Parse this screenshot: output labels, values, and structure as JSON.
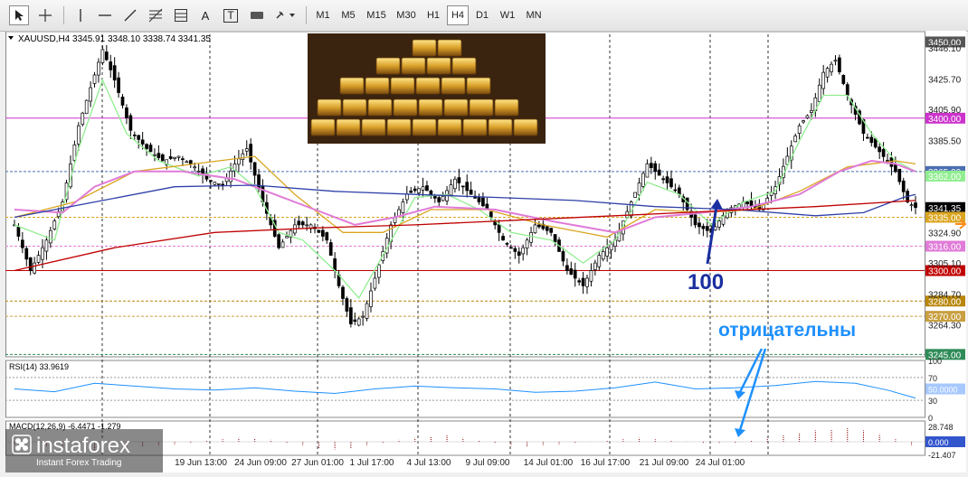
{
  "toolbar": {
    "tools": [
      {
        "name": "cursor-tool",
        "icon": "cursor-arrow-icon",
        "active": true
      },
      {
        "name": "crosshair-tool",
        "icon": "crosshair-icon"
      },
      {
        "name": "vertical-line-tool",
        "icon": "vertical-line-icon"
      },
      {
        "name": "horizontal-line-tool",
        "icon": "horizontal-line-icon"
      },
      {
        "name": "trendline-tool",
        "icon": "trendline-icon"
      },
      {
        "name": "fibonacci-tool",
        "icon": "fibonacci-grid-icon"
      },
      {
        "name": "text-tool",
        "icon": "text-a-icon",
        "label": "A"
      },
      {
        "name": "text-label-tool",
        "icon": "text-label-icon",
        "label": "T"
      },
      {
        "name": "rectangle-tool",
        "icon": "rectangle-icon"
      },
      {
        "name": "shapes-tool",
        "icon": "shapes-dropdown-icon"
      }
    ],
    "timeframes": [
      "M1",
      "M5",
      "M15",
      "M30",
      "H1",
      "H4",
      "D1",
      "W1",
      "MN"
    ],
    "active_timeframe": "H4"
  },
  "chart_data": {
    "type": "line",
    "title": "XAUUSD,H4  3345.91 3348.10 3338.74 3341.35",
    "symbol": "XAUUSD",
    "timeframe": "H4",
    "ohlc": {
      "open": 3345.91,
      "high": 3348.1,
      "low": 3338.74,
      "close": 3341.35
    },
    "ylim": [
      3244,
      3455
    ],
    "y_ticks": [
      "3446.10",
      "3425.70",
      "3405.90",
      "3385.50",
      "3324.90",
      "3305.10",
      "3284.70",
      "3264.30"
    ],
    "x_ticks": [
      "19 Jun 13:00",
      "24 Jun 09:00",
      "27 Jun 01:00",
      "1 Jul 17:00",
      "4 Jul 13:00",
      "9 Jul 09:00",
      "14 Jul 01:00",
      "16 Jul 17:00",
      "21 Jul 09:00",
      "24 Jul 01:00"
    ],
    "price_points": [
      [
        0,
        3330
      ],
      [
        4,
        3300
      ],
      [
        8,
        3320
      ],
      [
        12,
        3345
      ],
      [
        16,
        3395
      ],
      [
        19,
        3420
      ],
      [
        22,
        3445
      ],
      [
        25,
        3425
      ],
      [
        29,
        3392
      ],
      [
        33,
        3380
      ],
      [
        37,
        3372
      ],
      [
        41,
        3375
      ],
      [
        45,
        3368
      ],
      [
        48,
        3360
      ],
      [
        52,
        3356
      ],
      [
        55,
        3370
      ],
      [
        58,
        3380
      ],
      [
        62,
        3345
      ],
      [
        66,
        3315
      ],
      [
        70,
        3330
      ],
      [
        74,
        3330
      ],
      [
        78,
        3320
      ],
      [
        81,
        3290
      ],
      [
        84,
        3265
      ],
      [
        87,
        3270
      ],
      [
        90,
        3295
      ],
      [
        94,
        3330
      ],
      [
        98,
        3350
      ],
      [
        102,
        3355
      ],
      [
        106,
        3345
      ],
      [
        110,
        3360
      ],
      [
        114,
        3350
      ],
      [
        118,
        3340
      ],
      [
        122,
        3320
      ],
      [
        126,
        3310
      ],
      [
        130,
        3330
      ],
      [
        134,
        3325
      ],
      [
        138,
        3300
      ],
      [
        142,
        3290
      ],
      [
        146,
        3310
      ],
      [
        150,
        3320
      ],
      [
        154,
        3345
      ],
      [
        158,
        3370
      ],
      [
        162,
        3360
      ],
      [
        166,
        3350
      ],
      [
        170,
        3330
      ],
      [
        174,
        3325
      ],
      [
        178,
        3340
      ],
      [
        182,
        3345
      ],
      [
        186,
        3340
      ],
      [
        190,
        3355
      ],
      [
        193,
        3375
      ],
      [
        196,
        3395
      ],
      [
        199,
        3405
      ],
      [
        202,
        3430
      ],
      [
        205,
        3438
      ],
      [
        208,
        3415
      ],
      [
        212,
        3390
      ],
      [
        216,
        3378
      ],
      [
        220,
        3365
      ],
      [
        223,
        3345
      ],
      [
        225,
        3341.35
      ]
    ],
    "moving_averages": [
      {
        "color": "#90ee90",
        "points": [
          [
            0,
            3330
          ],
          [
            10,
            3320
          ],
          [
            16,
            3380
          ],
          [
            22,
            3425
          ],
          [
            28,
            3390
          ],
          [
            36,
            3372
          ],
          [
            46,
            3362
          ],
          [
            54,
            3368
          ],
          [
            60,
            3355
          ],
          [
            66,
            3325
          ],
          [
            72,
            3320
          ],
          [
            80,
            3300
          ],
          [
            86,
            3282
          ],
          [
            92,
            3310
          ],
          [
            100,
            3348
          ],
          [
            108,
            3350
          ],
          [
            116,
            3340
          ],
          [
            124,
            3325
          ],
          [
            134,
            3320
          ],
          [
            142,
            3305
          ],
          [
            150,
            3320
          ],
          [
            158,
            3358
          ],
          [
            166,
            3350
          ],
          [
            174,
            3330
          ],
          [
            182,
            3345
          ],
          [
            190,
            3352
          ],
          [
            196,
            3385
          ],
          [
            202,
            3415
          ],
          [
            208,
            3415
          ],
          [
            214,
            3390
          ],
          [
            220,
            3372
          ],
          [
            225,
            3365
          ]
        ]
      },
      {
        "color": "#daa520",
        "points": [
          [
            0,
            3335
          ],
          [
            15,
            3345
          ],
          [
            30,
            3365
          ],
          [
            45,
            3370
          ],
          [
            60,
            3375
          ],
          [
            70,
            3350
          ],
          [
            82,
            3325
          ],
          [
            92,
            3325
          ],
          [
            104,
            3340
          ],
          [
            118,
            3340
          ],
          [
            132,
            3330
          ],
          [
            148,
            3322
          ],
          [
            160,
            3340
          ],
          [
            172,
            3338
          ],
          [
            184,
            3340
          ],
          [
            196,
            3352
          ],
          [
            208,
            3368
          ],
          [
            220,
            3372
          ],
          [
            225,
            3370
          ]
        ]
      },
      {
        "color": "#e07bd8",
        "points": [
          [
            0,
            3340
          ],
          [
            12,
            3338
          ],
          [
            20,
            3355
          ],
          [
            30,
            3365
          ],
          [
            42,
            3365
          ],
          [
            55,
            3360
          ],
          [
            65,
            3350
          ],
          [
            75,
            3340
          ],
          [
            85,
            3330
          ],
          [
            95,
            3335
          ],
          [
            105,
            3342
          ],
          [
            120,
            3340
          ],
          [
            135,
            3332
          ],
          [
            150,
            3325
          ],
          [
            160,
            3335
          ],
          [
            172,
            3338
          ],
          [
            184,
            3342
          ],
          [
            196,
            3350
          ],
          [
            206,
            3365
          ],
          [
            214,
            3372
          ],
          [
            220,
            3370
          ],
          [
            225,
            3365
          ]
        ]
      },
      {
        "color": "#2e3fa8",
        "points": [
          [
            0,
            3335
          ],
          [
            20,
            3345
          ],
          [
            40,
            3355
          ],
          [
            60,
            3356
          ],
          [
            80,
            3352
          ],
          [
            100,
            3350
          ],
          [
            120,
            3348
          ],
          [
            140,
            3346
          ],
          [
            160,
            3342
          ],
          [
            180,
            3340
          ],
          [
            200,
            3336
          ],
          [
            212,
            3338
          ],
          [
            222,
            3348
          ],
          [
            225,
            3350
          ]
        ]
      },
      {
        "color": "#c00000",
        "points": [
          [
            0,
            3300
          ],
          [
            25,
            3315
          ],
          [
            50,
            3325
          ],
          [
            75,
            3328
          ],
          [
            100,
            3330
          ],
          [
            125,
            3333
          ],
          [
            150,
            3336
          ],
          [
            175,
            3339
          ],
          [
            200,
            3342
          ],
          [
            225,
            3346
          ]
        ]
      }
    ],
    "levels": [
      {
        "value": 3450.0,
        "label": "3450.00",
        "color": "#555555",
        "line": false
      },
      {
        "value": 3400.0,
        "label": "3400.00",
        "color": "#cc33cc",
        "line": true
      },
      {
        "value": 3365.0,
        "label": "3365.00",
        "color": "#4a6fb0",
        "line": true,
        "dash": true
      },
      {
        "value": 3362.0,
        "label": "3362.00",
        "color": "#90ee90",
        "line": false
      },
      {
        "value": 3341.35,
        "label": "3341.35",
        "color": "#000000",
        "line": false
      },
      {
        "value": 3335.0,
        "label": "3335.00",
        "color": "#daa520",
        "line": true,
        "dash": true
      },
      {
        "value": 3316.0,
        "label": "3316.00",
        "color": "#e07bd8",
        "line": true,
        "dash": true
      },
      {
        "value": 3300.0,
        "label": "3300.00",
        "color": "#c00000",
        "line": true
      },
      {
        "value": 3280.0,
        "label": "3280.00",
        "color": "#b8860b",
        "line": true,
        "dash": true
      },
      {
        "value": 3270.0,
        "label": "3270.00",
        "color": "#c8a040",
        "line": true,
        "dash": true
      },
      {
        "value": 3245.0,
        "label": "3245.00",
        "color": "#2e8b57",
        "line": true,
        "dash": true
      }
    ],
    "annotations": [
      {
        "text": "100",
        "color": "#1a2fa0"
      },
      {
        "text": "отрицательны",
        "color": "#1e90ff"
      }
    ],
    "rsi": {
      "label": "RSI(14) 33.9619",
      "ylim": [
        0,
        100
      ],
      "ticks": [
        "100",
        "70",
        "30",
        "0"
      ],
      "level_label": "50.0000",
      "points": [
        [
          0,
          50
        ],
        [
          10,
          45
        ],
        [
          20,
          60
        ],
        [
          30,
          55
        ],
        [
          40,
          50
        ],
        [
          50,
          48
        ],
        [
          60,
          52
        ],
        [
          70,
          46
        ],
        [
          80,
          42
        ],
        [
          90,
          50
        ],
        [
          100,
          55
        ],
        [
          110,
          52
        ],
        [
          120,
          50
        ],
        [
          130,
          44
        ],
        [
          140,
          46
        ],
        [
          150,
          52
        ],
        [
          160,
          62
        ],
        [
          170,
          50
        ],
        [
          180,
          52
        ],
        [
          190,
          56
        ],
        [
          200,
          63
        ],
        [
          210,
          60
        ],
        [
          218,
          48
        ],
        [
          225,
          34
        ]
      ]
    },
    "macd": {
      "label": "MACD(12,26,9) -6.4471 -1.279",
      "ticks": [
        "28.748",
        "-21.407"
      ],
      "zero_label": "0.000",
      "histogram": [
        -4,
        -6,
        -8,
        -10,
        -12,
        -14,
        -12,
        -10,
        -8,
        -6,
        -4,
        -2,
        2,
        4,
        6,
        5,
        3,
        -2,
        -6,
        -10,
        -12,
        -10,
        -6,
        -2,
        3,
        6,
        8,
        10,
        6,
        2,
        -2,
        -6,
        -8,
        -6,
        -4,
        -2,
        0,
        2,
        4,
        6,
        4,
        2,
        0,
        -2,
        -3,
        -2,
        2,
        6,
        10,
        14,
        18,
        20,
        22,
        18,
        12,
        4,
        -6
      ]
    }
  },
  "watermark": {
    "brand": "instaforex",
    "tagline": "Instant Forex Trading"
  },
  "colors": {
    "candle": "#000000",
    "grid": "#000000",
    "bg": "#ffffff"
  }
}
